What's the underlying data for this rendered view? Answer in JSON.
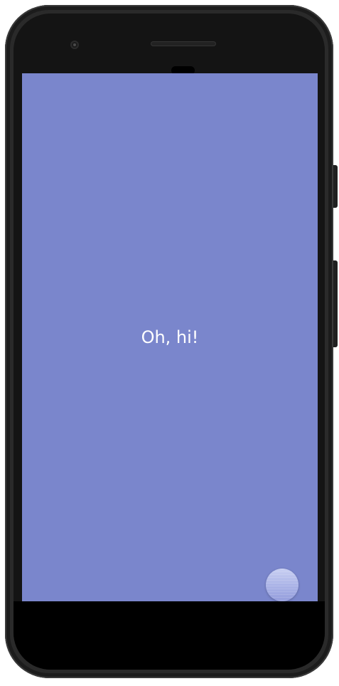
{
  "device": {
    "frame_color": "#2a2a2a",
    "bezel_color": "#141414"
  },
  "screen": {
    "background_color": "#7a86cc",
    "message": "Oh, hi!",
    "message_color": "#ffffff"
  },
  "fab": {
    "icon": "circle-button-icon",
    "color": "#a9b2e6"
  }
}
